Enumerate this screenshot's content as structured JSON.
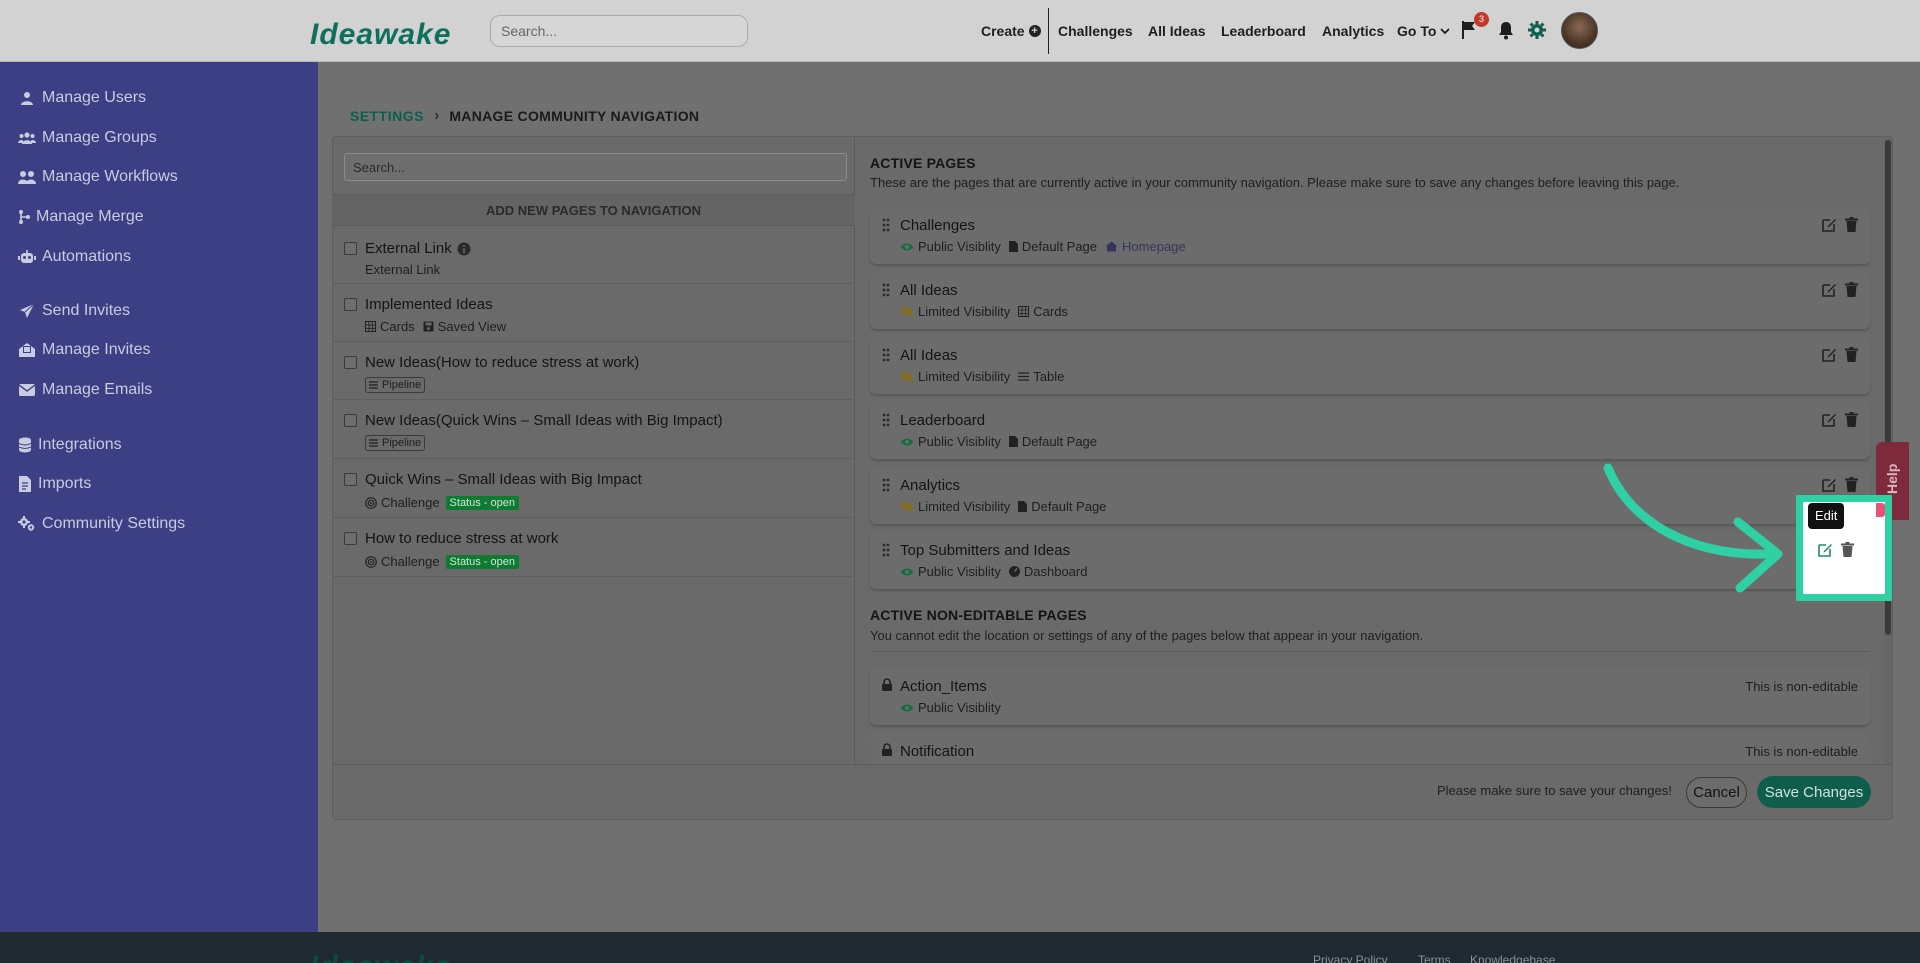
{
  "topbar": {
    "logo": "Ideawake",
    "search_placeholder": "Search...",
    "nav": {
      "create": "Create",
      "challenges": "Challenges",
      "all_ideas": "All Ideas",
      "leaderboard": "Leaderboard",
      "analytics": "Analytics",
      "go_to": "Go To"
    },
    "flag_badge": "3"
  },
  "sidebar": {
    "items": [
      {
        "label": "Manage Users",
        "icon": "user-icon"
      },
      {
        "label": "Manage Groups",
        "icon": "users-icon"
      },
      {
        "label": "Manage Workflows",
        "icon": "workflow-icon"
      },
      {
        "label": "Manage Merge",
        "icon": "merge-icon"
      },
      {
        "label": "Automations",
        "icon": "robot-icon"
      },
      {
        "label": "Send Invites",
        "icon": "paper-plane-icon"
      },
      {
        "label": "Manage Invites",
        "icon": "invites-icon"
      },
      {
        "label": "Manage Emails",
        "icon": "envelope-icon"
      },
      {
        "label": "Integrations",
        "icon": "database-icon"
      },
      {
        "label": "Imports",
        "icon": "file-import-icon"
      },
      {
        "label": "Community Settings",
        "icon": "gears-icon"
      }
    ]
  },
  "breadcrumb": {
    "root": "SETTINGS",
    "current": "MANAGE COMMUNITY NAVIGATION"
  },
  "left_panel": {
    "search_placeholder": "Search...",
    "header": "ADD NEW PAGES TO NAVIGATION",
    "items": [
      {
        "title": "External Link",
        "meta": [
          "External Link"
        ]
      },
      {
        "title": "Implemented Ideas",
        "meta": [
          "Cards",
          "Saved View"
        ]
      },
      {
        "title": "New Ideas(How to reduce stress at work)",
        "meta": [
          "Pipeline"
        ]
      },
      {
        "title": "New Ideas(Quick Wins – Small Ideas with Big Impact)",
        "meta": [
          "Pipeline"
        ]
      },
      {
        "title": "Quick Wins – Small Ideas with Big Impact",
        "meta": [
          "Challenge",
          "Status - open"
        ]
      },
      {
        "title": "How to reduce stress at work",
        "meta": [
          "Challenge",
          "Status - open"
        ]
      }
    ]
  },
  "active_pages": {
    "title": "ACTIVE PAGES",
    "description": "These are the pages that are currently active in your community navigation. Please make sure to save any changes before leaving this page.",
    "rows": [
      {
        "name": "Challenges",
        "visibility": "Public Visiblity",
        "type": "Default Page",
        "extra": "Homepage"
      },
      {
        "name": "All Ideas",
        "visibility": "Limited Visibility",
        "type": "Cards"
      },
      {
        "name": "All Ideas",
        "visibility": "Limited Visibility",
        "type": "Table"
      },
      {
        "name": "Leaderboard",
        "visibility": "Public Visiblity",
        "type": "Default Page"
      },
      {
        "name": "Analytics",
        "visibility": "Limited Visibility",
        "type": "Default Page"
      },
      {
        "name": "Top Submitters and Ideas",
        "visibility": "Public Visiblity",
        "type": "Dashboard"
      }
    ]
  },
  "non_editable": {
    "title": "ACTIVE NON-EDITABLE PAGES",
    "description": "You cannot edit the location or settings of any of the pages below that appear in your navigation.",
    "note": "This is non-editable",
    "rows": [
      {
        "name": "Action_Items",
        "visibility": "Public Visiblity"
      },
      {
        "name": "Notification",
        "visibility": ""
      }
    ]
  },
  "footer": {
    "save_note": "Please make sure to save your changes!",
    "cancel": "Cancel",
    "save": "Save Changes"
  },
  "help": "Help",
  "tooltip": "Edit",
  "site_footer": {
    "logo": "Ideawake",
    "links": [
      "Privacy Policy",
      "Terms",
      "Knowledgebase"
    ]
  },
  "colors": {
    "sidebar": "#3c3f84",
    "accent": "#0f5e4d",
    "highlight": "#2fd1a4",
    "help": "#7e2a3c"
  }
}
